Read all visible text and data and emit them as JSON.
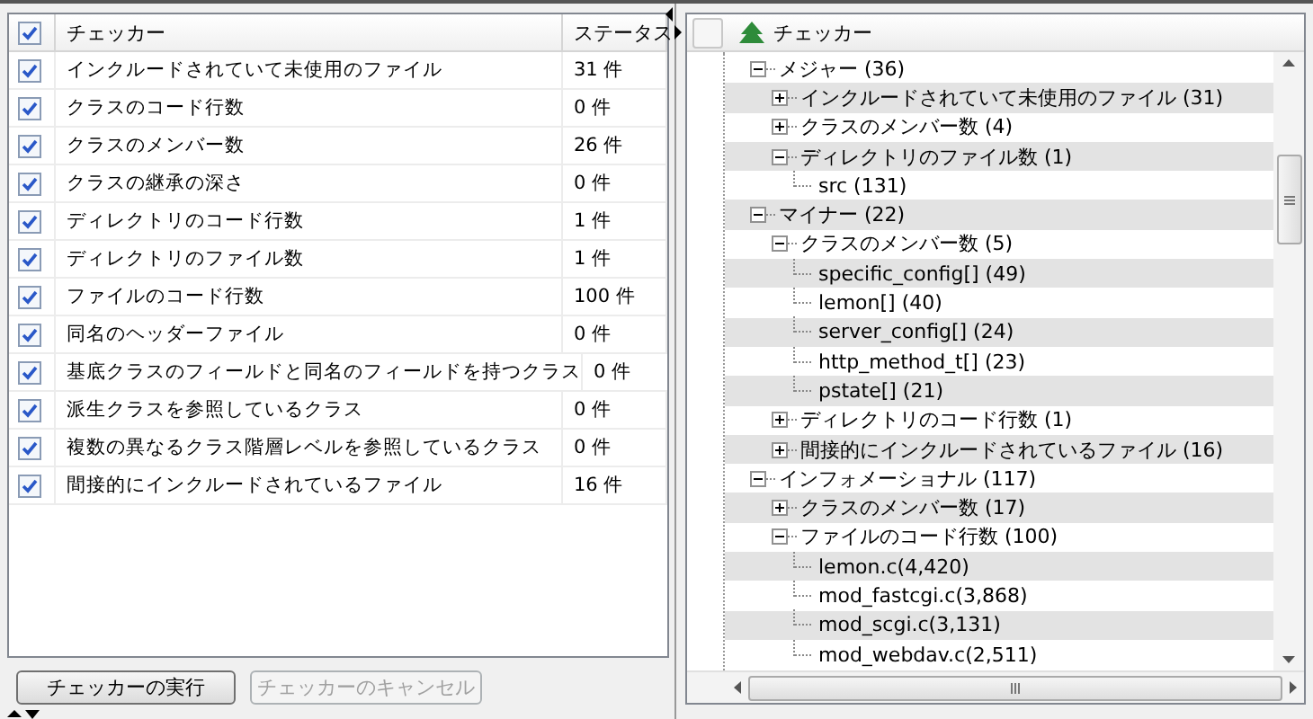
{
  "table": {
    "all_checked": true,
    "columns": [
      "チェッカー",
      "ステータス"
    ],
    "rows": [
      {
        "checked": true,
        "name": "インクルードされていて未使用のファイル",
        "status": "31 件"
      },
      {
        "checked": true,
        "name": "クラスのコード行数",
        "status": "0 件"
      },
      {
        "checked": true,
        "name": "クラスのメンバー数",
        "status": "26 件"
      },
      {
        "checked": true,
        "name": "クラスの継承の深さ",
        "status": "0 件"
      },
      {
        "checked": true,
        "name": "ディレクトリのコード行数",
        "status": "1 件"
      },
      {
        "checked": true,
        "name": "ディレクトリのファイル数",
        "status": "1 件"
      },
      {
        "checked": true,
        "name": "ファイルのコード行数",
        "status": "100 件"
      },
      {
        "checked": true,
        "name": "同名のヘッダーファイル",
        "status": "0 件"
      },
      {
        "checked": true,
        "name": "基底クラスのフィールドと同名のフィールドを持つクラス",
        "status": "0 件"
      },
      {
        "checked": true,
        "name": "派生クラスを参照しているクラス",
        "status": "0 件"
      },
      {
        "checked": true,
        "name": "複数の異なるクラス階層レベルを参照しているクラス",
        "status": "0 件"
      },
      {
        "checked": true,
        "name": "間接的にインクルードされているファイル",
        "status": "16 件"
      }
    ]
  },
  "buttons": [
    {
      "label": "チェッカーの実行",
      "disabled": false
    },
    {
      "label": "チェッカーのキャンセル",
      "disabled": true
    }
  ],
  "tree": {
    "header_checked": false,
    "header": "チェッカー",
    "items": [
      {
        "label": "メジャー (36)",
        "expanded": true,
        "children": [
          {
            "label": "インクルードされていて未使用のファイル (31)",
            "expanded": false
          },
          {
            "label": "クラスのメンバー数 (4)",
            "expanded": false
          },
          {
            "label": "ディレクトリのファイル数 (1)",
            "expanded": true,
            "children": [
              {
                "label": "src (131)"
              }
            ]
          }
        ]
      },
      {
        "label": "マイナー (22)",
        "expanded": true,
        "children": [
          {
            "label": "クラスのメンバー数 (5)",
            "expanded": true,
            "children": [
              {
                "label": "specific_config[] (49)"
              },
              {
                "label": "lemon[] (40)"
              },
              {
                "label": "server_config[] (24)"
              },
              {
                "label": "http_method_t[] (23)"
              },
              {
                "label": "pstate[] (21)"
              }
            ]
          },
          {
            "label": "ディレクトリのコード行数 (1)",
            "expanded": false
          },
          {
            "label": "間接的にインクルードされているファイル (16)",
            "expanded": false
          }
        ]
      },
      {
        "label": "インフォメーショナル (117)",
        "expanded": true,
        "children": [
          {
            "label": "クラスのメンバー数 (17)",
            "expanded": false
          },
          {
            "label": "ファイルのコード行数 (100)",
            "expanded": true,
            "children": [
              {
                "label": "lemon.c(4,420)"
              },
              {
                "label": "mod_fastcgi.c(3,868)"
              },
              {
                "label": "mod_scgi.c(3,131)"
              },
              {
                "label": "mod_webdav.c(2,511)"
              }
            ]
          }
        ]
      }
    ]
  }
}
